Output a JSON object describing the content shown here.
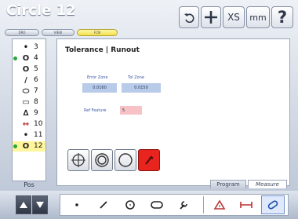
{
  "header": {
    "title": "Circle 12",
    "tabs": [
      "DRO",
      "VIEW",
      "FCN"
    ],
    "tool_buttons": {
      "undo_icon": "undo-icon",
      "plus_icon": "crosshair-plus-icon",
      "xs_label": "XS",
      "mm_label": "mm",
      "help_label": "?"
    }
  },
  "features": [
    {
      "num": "3",
      "icon": "point-icon",
      "symbol": "•",
      "selected": false,
      "marked": false
    },
    {
      "num": "4",
      "icon": "circle-icon",
      "symbol": "O",
      "selected": false,
      "marked": true
    },
    {
      "num": "5",
      "icon": "circle-icon",
      "symbol": "O",
      "selected": false,
      "marked": false
    },
    {
      "num": "6",
      "icon": "line-icon",
      "symbol": "/",
      "selected": false,
      "marked": false
    },
    {
      "num": "7",
      "icon": "slot-icon",
      "symbol": "⬭",
      "selected": false,
      "marked": false
    },
    {
      "num": "8",
      "icon": "rectangle-icon",
      "symbol": "▭",
      "selected": false,
      "marked": false
    },
    {
      "num": "9",
      "icon": "angle-icon",
      "symbol": "∆",
      "selected": false,
      "marked": false
    },
    {
      "num": "10",
      "icon": "distance-icon",
      "symbol": "↔",
      "selected": false,
      "marked": false
    },
    {
      "num": "11",
      "icon": "point-icon",
      "symbol": "•",
      "selected": false,
      "marked": false
    },
    {
      "num": "12",
      "icon": "circle-icon",
      "symbol": "O",
      "selected": true,
      "marked": true
    }
  ],
  "sidebar": {
    "footer_label": "Pos"
  },
  "panel": {
    "title": "Tolerance | Runout",
    "error_zone_label": "Error Zone",
    "tol_zone_label": "Tol Zone",
    "error_zone_value": "0.0160",
    "tol_zone_value": "0.0150",
    "ref_feature_label": "Ref Feature",
    "ref_feature_value": "5",
    "options": [
      "crosshair-circle-icon",
      "concentric-circle-icon",
      "single-circle-icon",
      "wand-icon"
    ],
    "active_option": "wand-icon"
  },
  "lower_tabs": {
    "program": "Program",
    "measure": "Measure"
  },
  "measure_tools": [
    "point-icon",
    "line-icon",
    "circle-icon",
    "slot-icon",
    "wrench-icon",
    "angle-icon",
    "distance-icon",
    "skew-slot-icon"
  ],
  "colors": {
    "accent_red": "#e8241f",
    "selected_yellow": "#fff59a",
    "value_blue": "#b8cbe8",
    "ref_pink": "#f6c2c6"
  }
}
